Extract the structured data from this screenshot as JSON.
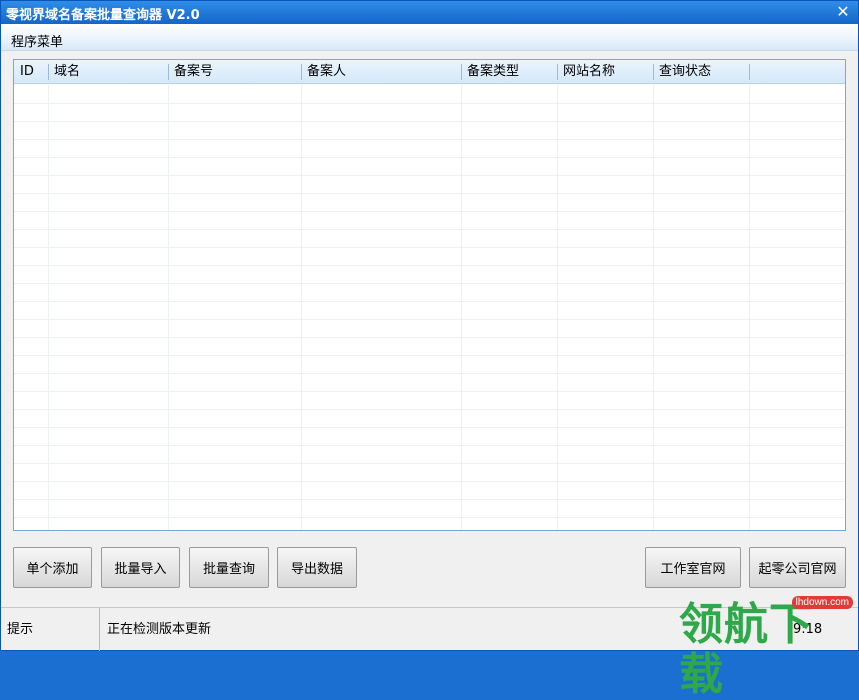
{
  "window": {
    "title": "零视界域名备案批量查询器 V2.0",
    "close_glyph": "✕"
  },
  "menu": {
    "items": [
      {
        "label": "程序菜单"
      }
    ]
  },
  "table": {
    "columns": [
      {
        "label": "ID"
      },
      {
        "label": "域名"
      },
      {
        "label": "备案号"
      },
      {
        "label": "备案人"
      },
      {
        "label": "备案类型"
      },
      {
        "label": "网站名称"
      },
      {
        "label": "查询状态"
      }
    ],
    "rows": []
  },
  "buttons": {
    "add_single": "单个添加",
    "batch_import": "批量导入",
    "batch_query": "批量查询",
    "export_data": "导出数据",
    "studio_site": "工作室官网",
    "company_site": "起零公司官网"
  },
  "status": {
    "label": "提示",
    "message": "正在检测版本更新",
    "version": "9:18"
  },
  "watermark": {
    "text": "领航下载",
    "url": "lhdown.com"
  },
  "colors": {
    "titlebar": "#1a74d8",
    "grid_border": "#7aa6d6",
    "header_bg": "#d5e8f9",
    "watermark_green": "#2ea84a"
  }
}
